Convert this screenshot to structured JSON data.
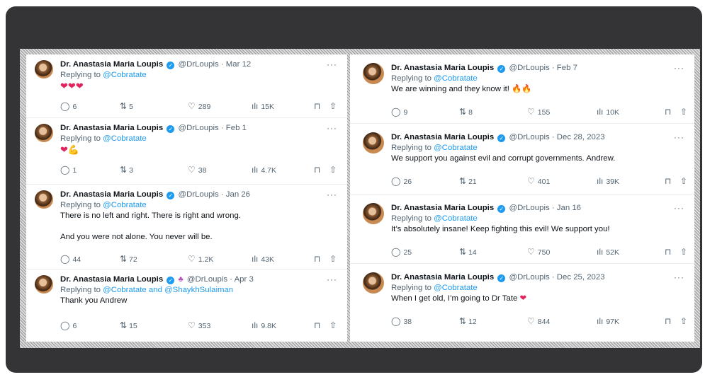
{
  "left_column": [
    {
      "name": "Dr. Anastasia Maria Loupis",
      "handle": "@DrLoupis",
      "date": "· Mar 12",
      "replying_prefix": "Replying to",
      "replying_to": "@Cobratate",
      "emojis": [
        "heart",
        "heart",
        "heart"
      ],
      "stats": {
        "replies": "6",
        "reposts": "5",
        "likes": "289",
        "views": "15K"
      }
    },
    {
      "name": "Dr. Anastasia Maria Loupis",
      "handle": "@DrLoupis",
      "date": "· Feb 1",
      "replying_prefix": "Replying to",
      "replying_to": "@Cobratate",
      "emojis": [
        "heart",
        "flexed-biceps"
      ],
      "stats": {
        "replies": "1",
        "reposts": "3",
        "likes": "38",
        "views": "4.7K"
      }
    },
    {
      "name": "Dr. Anastasia Maria Loupis",
      "handle": "@DrLoupis",
      "date": "· Jan 26",
      "replying_prefix": "Replying to",
      "replying_to": "@Cobratate",
      "text1": "There is no left and right. There is right and wrong.",
      "text2": "And you were not alone. You never will be.",
      "stats": {
        "replies": "44",
        "reposts": "72",
        "likes": "1.2K",
        "views": "43K"
      }
    },
    {
      "name": "Dr. Anastasia Maria Loupis",
      "handle": "@DrLoupis",
      "date": "· Apr 3",
      "replying_prefix": "Replying to",
      "replying_to": "@Cobratate and @ShaykhSulaiman",
      "text1": "Thank you Andrew",
      "stats": {
        "replies": "6",
        "reposts": "15",
        "likes": "353",
        "views": "9.8K"
      }
    }
  ],
  "right_column": [
    {
      "name": "Dr. Anastasia Maria Loupis",
      "handle": "@DrLoupis",
      "date": "· Feb 7",
      "replying_prefix": "Replying to",
      "replying_to": "@Cobratate",
      "text1": "We are winning and they know it!",
      "emojis": [
        "fire",
        "fire"
      ],
      "stats": {
        "replies": "9",
        "reposts": "8",
        "likes": "155",
        "views": "10K"
      }
    },
    {
      "name": "Dr. Anastasia Maria Loupis",
      "handle": "@DrLoupis",
      "date": "· Dec 28, 2023",
      "replying_prefix": "Replying to",
      "replying_to": "@Cobratate",
      "text1": "We support you against evil and corrupt governments. Andrew.",
      "stats": {
        "replies": "26",
        "reposts": "21",
        "likes": "401",
        "views": "39K"
      }
    },
    {
      "name": "Dr. Anastasia Maria Loupis",
      "handle": "@DrLoupis",
      "date": "· Jan 16",
      "replying_prefix": "Replying to",
      "replying_to": "@Cobratate",
      "text1": "It’s absolutely insane! Keep fighting this evil! We support you!",
      "stats": {
        "replies": "25",
        "reposts": "14",
        "likes": "750",
        "views": "52K"
      }
    },
    {
      "name": "Dr. Anastasia Maria Loupis",
      "handle": "@DrLoupis",
      "date": "· Dec 25, 2023",
      "replying_prefix": "Replying to",
      "replying_to": "@Cobratate",
      "text1": "When I get old, I’m going to Dr Tate",
      "emojis": [
        "heart"
      ],
      "stats": {
        "replies": "38",
        "reposts": "12",
        "likes": "844",
        "views": "97K"
      }
    }
  ],
  "colors": {
    "link": "#1d9bf0",
    "muted": "#536471",
    "text": "#0f1419",
    "frame": "#343437"
  },
  "icons": {
    "reply": "comment-icon",
    "repost": "repost-icon",
    "like": "heart-icon",
    "views": "views-icon",
    "bookmark": "bookmark-icon",
    "share": "share-icon",
    "more": "more-icon",
    "verified": "verified-badge-icon"
  }
}
